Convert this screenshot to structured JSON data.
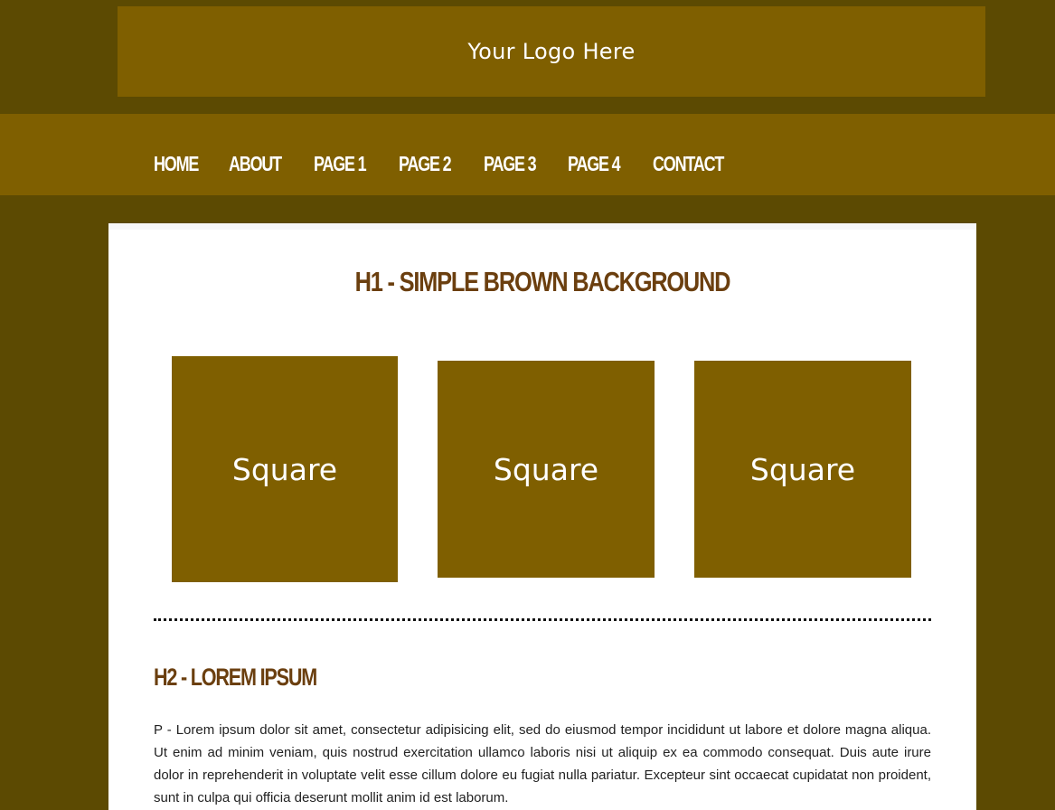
{
  "header": {
    "logo_text": "Your Logo Here"
  },
  "nav": {
    "items": [
      {
        "label": "HOME"
      },
      {
        "label": "ABOUT"
      },
      {
        "label": "PAGE 1"
      },
      {
        "label": "PAGE 2"
      },
      {
        "label": "PAGE 3"
      },
      {
        "label": "PAGE 4"
      },
      {
        "label": "CONTACT"
      }
    ]
  },
  "main": {
    "h1": "H1 - SIMPLE BROWN BACKGROUND",
    "squares": [
      {
        "label": "Square"
      },
      {
        "label": "Square"
      },
      {
        "label": "Square"
      }
    ],
    "h2": "H2 - LOREM IPSUM",
    "paragraph": "P - Lorem ipsum dolor sit amet, consectetur adipisicing elit, sed do eiusmod tempor incididunt ut labore et dolore magna aliqua. Ut enim ad minim veniam, quis nostrud exercitation ullamco laboris nisi ut aliquip ex ea commodo consequat. Duis aute irure dolor in reprehenderit in voluptate velit esse cillum dolore eu fugiat nulla pariatur. Excepteur sint occaecat cupidatat non proident, sunt in culpa qui officia deserunt mollit anim id est laborum."
  },
  "colors": {
    "page_background": "#5c4a02",
    "accent_brown": "#7f5f00",
    "heading_brown": "#6b3f0f",
    "content_background": "#ffffff"
  }
}
